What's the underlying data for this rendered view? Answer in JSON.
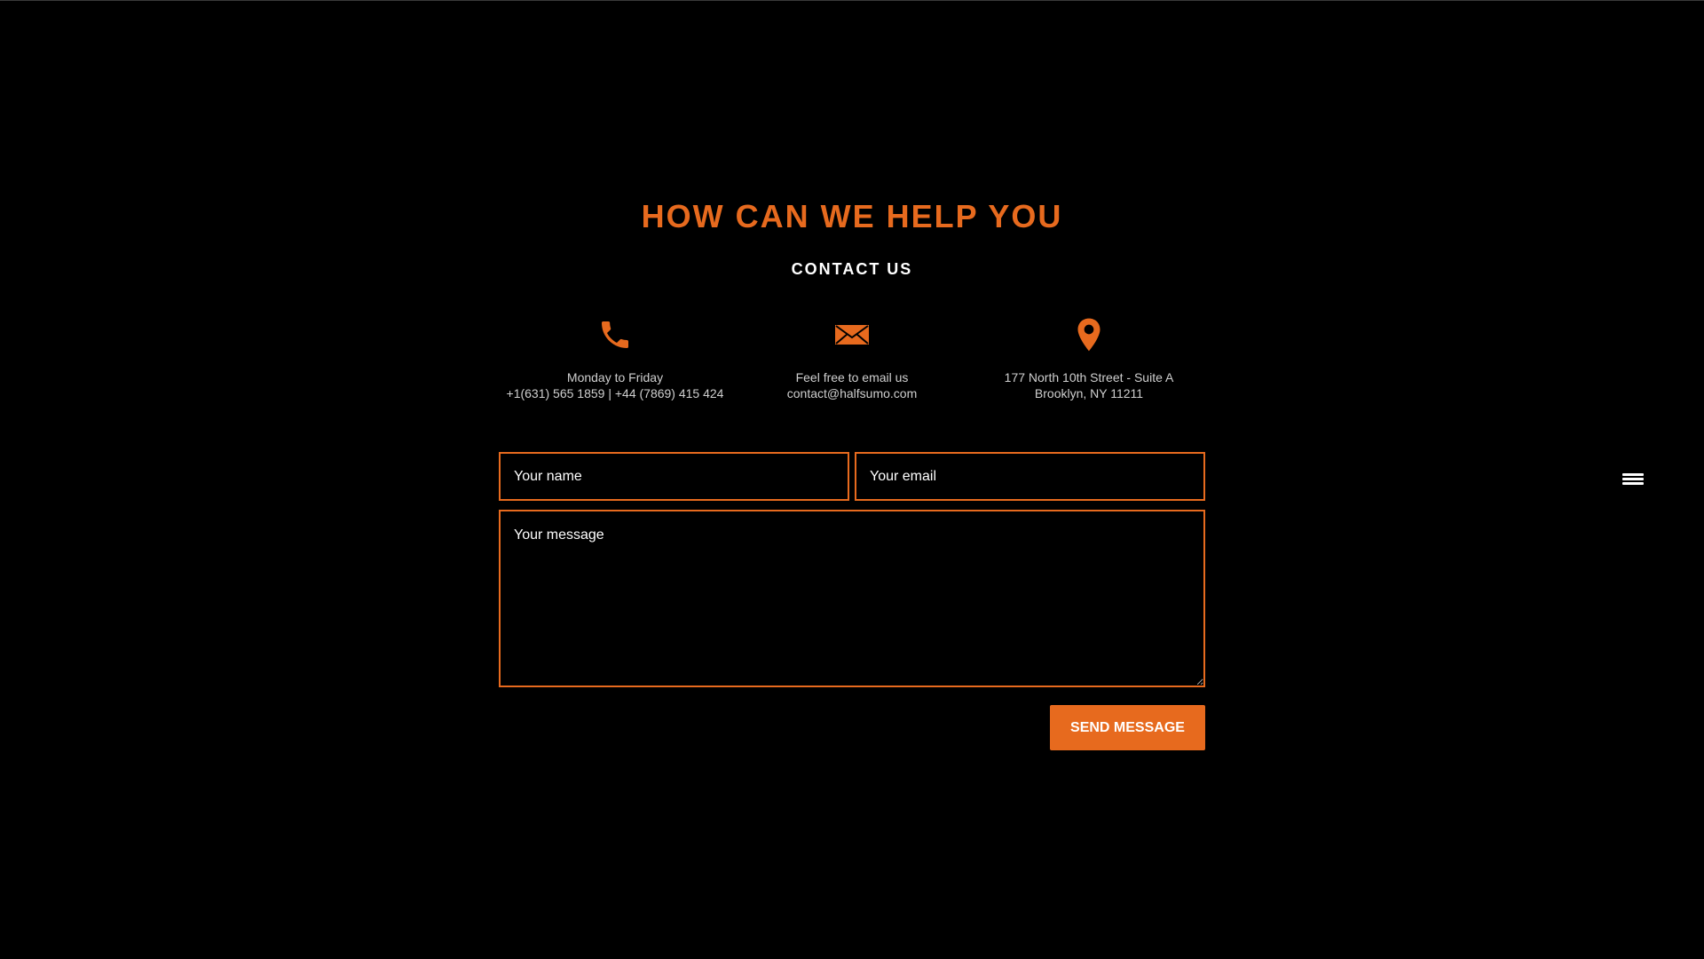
{
  "section": {
    "title": "HOW CAN WE HELP YOU",
    "subtitle": "CONTACT US"
  },
  "contact_info": [
    {
      "icon": "phone-icon",
      "line1": "Monday to Friday",
      "line2": "+1(631) 565 1859 | +44 (7869) 415 424"
    },
    {
      "icon": "envelope-icon",
      "line1": "Feel free to email us",
      "line2": "contact@halfsumo.com"
    },
    {
      "icon": "map-pin-icon",
      "line1": "177 North 10th Street - Suite A",
      "line2": "Brooklyn, NY 11211"
    }
  ],
  "form": {
    "name_placeholder": "Your name",
    "email_placeholder": "Your email",
    "message_placeholder": "Your message",
    "submit_label": "SEND MESSAGE"
  },
  "nav": {
    "menu_icon": "hamburger-menu-icon"
  },
  "colors": {
    "background": "#000000",
    "accent": "#e76a1e",
    "text": "#ffffff",
    "muted_text": "#cfcfcf"
  }
}
